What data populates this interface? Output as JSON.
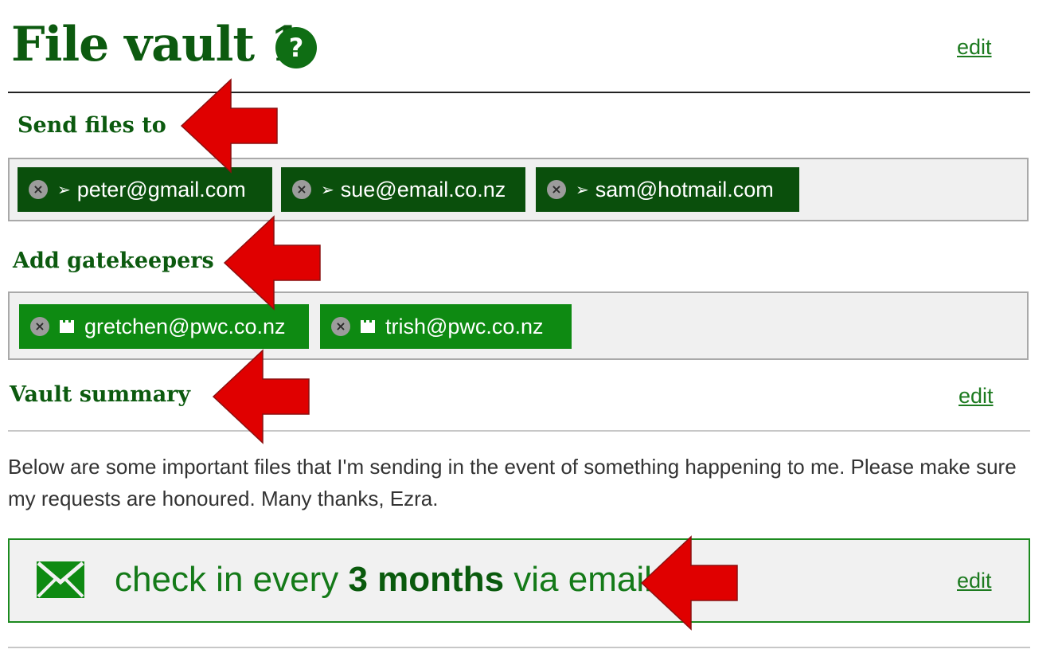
{
  "vault": {
    "title": "File vault 1",
    "help_icon": "?",
    "edit_label": "edit"
  },
  "send_files": {
    "heading": "Send files to",
    "recipients": [
      "peter@gmail.com",
      "sue@email.co.nz",
      "sam@hotmail.com"
    ]
  },
  "gatekeepers": {
    "heading": "Add gatekeepers",
    "members": [
      "gretchen@pwc.co.nz",
      "trish@pwc.co.nz"
    ]
  },
  "summary": {
    "heading": "Vault summary",
    "edit_label": "edit",
    "text": "Below are some important files that I'm sending in the event of something happening to me. Please make sure my requests are honoured. Many thanks, Ezra."
  },
  "checkin": {
    "prefix": "check in every",
    "interval": "3 months",
    "suffix": "via email",
    "edit_label": "edit"
  },
  "icons": {
    "remove": "circle-x-icon",
    "send": "send-arrow-icon",
    "gatekeeper": "castle-icon",
    "mail": "envelope-icon",
    "help": "question-icon",
    "annotation": "red-arrow-annotation"
  },
  "colors": {
    "brand_green": "#0c5a0f",
    "chip_dark": "#0a4f0c",
    "chip_green": "#0e8a12",
    "annotation_red": "#e00000"
  }
}
